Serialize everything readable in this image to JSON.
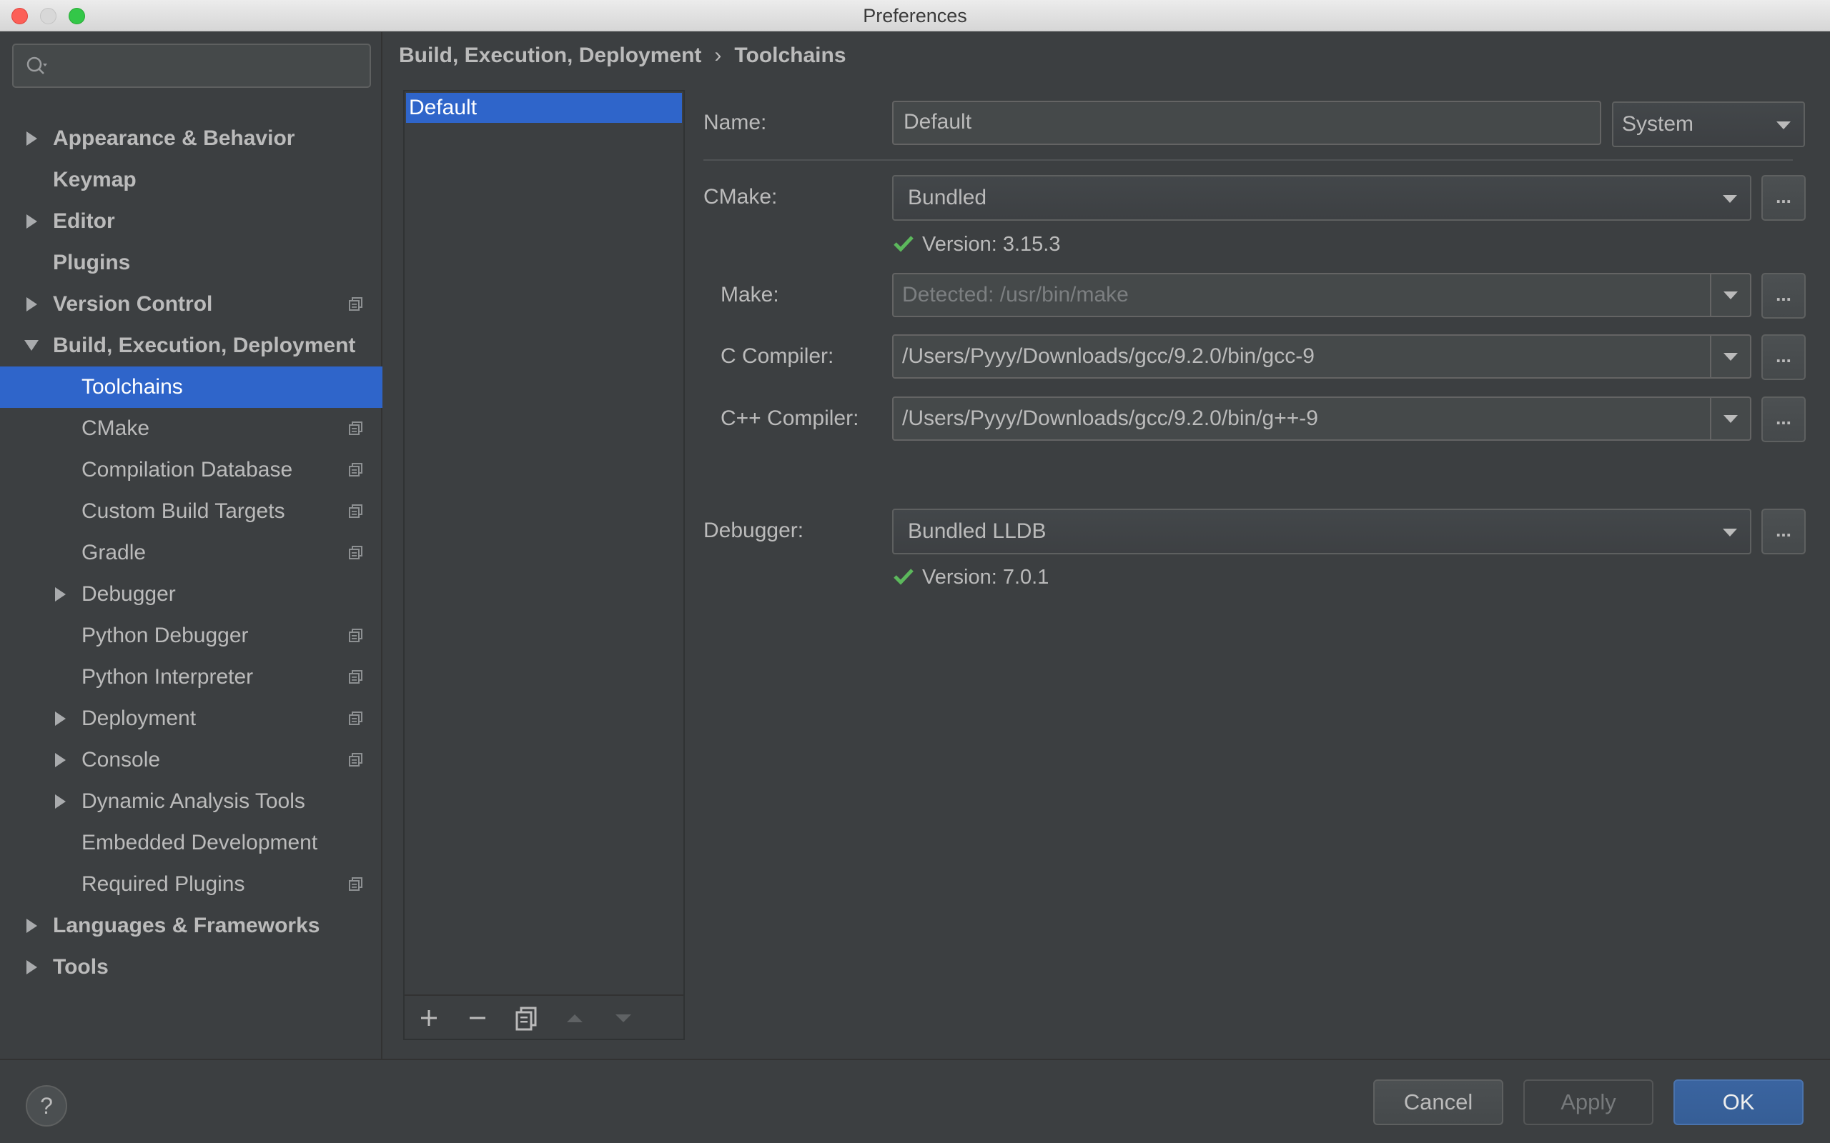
{
  "window": {
    "title": "Preferences"
  },
  "search": {
    "value": "",
    "placeholder": ""
  },
  "sidebar": {
    "items": [
      {
        "label": "Appearance & Behavior",
        "expandable": true,
        "expanded": false,
        "bold": true
      },
      {
        "label": "Keymap",
        "expandable": false,
        "bold": true
      },
      {
        "label": "Editor",
        "expandable": true,
        "expanded": false,
        "bold": true
      },
      {
        "label": "Plugins",
        "expandable": false,
        "bold": true
      },
      {
        "label": "Version Control",
        "expandable": true,
        "expanded": false,
        "bold": true,
        "project_icon": true
      },
      {
        "label": "Build, Execution, Deployment",
        "expandable": true,
        "expanded": true,
        "bold": true
      },
      {
        "label": "Toolchains",
        "selected": true,
        "indent": 1
      },
      {
        "label": "CMake",
        "indent": 1,
        "project_icon": true
      },
      {
        "label": "Compilation Database",
        "indent": 1,
        "project_icon": true
      },
      {
        "label": "Custom Build Targets",
        "indent": 1,
        "project_icon": true
      },
      {
        "label": "Gradle",
        "indent": 1,
        "project_icon": true
      },
      {
        "label": "Debugger",
        "indent": 1,
        "expandable": true,
        "expanded": false
      },
      {
        "label": "Python Debugger",
        "indent": 1,
        "project_icon": true
      },
      {
        "label": "Python Interpreter",
        "indent": 1,
        "project_icon": true
      },
      {
        "label": "Deployment",
        "indent": 1,
        "expandable": true,
        "expanded": false,
        "project_icon": true
      },
      {
        "label": "Console",
        "indent": 1,
        "expandable": true,
        "expanded": false,
        "project_icon": true
      },
      {
        "label": "Dynamic Analysis Tools",
        "indent": 1,
        "expandable": true,
        "expanded": false
      },
      {
        "label": "Embedded Development",
        "indent": 1
      },
      {
        "label": "Required Plugins",
        "indent": 1,
        "project_icon": true
      },
      {
        "label": "Languages & Frameworks",
        "expandable": true,
        "expanded": false,
        "bold": true
      },
      {
        "label": "Tools",
        "expandable": true,
        "expanded": false,
        "bold": true
      }
    ]
  },
  "breadcrumb": {
    "parent": "Build, Execution, Deployment",
    "separator": "›",
    "current": "Toolchains"
  },
  "toolchains": {
    "list": [
      "Default"
    ],
    "selected": "Default",
    "toolbar": {
      "add_icon": "plus-icon",
      "remove_icon": "minus-icon",
      "copy_icon": "copy-icon",
      "up_icon": "arrow-up-icon",
      "down_icon": "arrow-down-icon"
    }
  },
  "form": {
    "name_label": "Name:",
    "name_value": "Default",
    "environment": "System",
    "cmake_label": "CMake:",
    "cmake_value": "Bundled",
    "cmake_version": "Version: 3.15.3",
    "make_label": "Make:",
    "make_placeholder": "Detected: /usr/bin/make",
    "c_compiler_label": "C Compiler:",
    "c_compiler_value": "/Users/Pyyy/Downloads/gcc/9.2.0/bin/gcc-9",
    "cpp_compiler_label": "C++ Compiler:",
    "cpp_compiler_value": "/Users/Pyyy/Downloads/gcc/9.2.0/bin/g++-9",
    "debugger_label": "Debugger:",
    "debugger_value": "Bundled LLDB",
    "debugger_version": "Version: 7.0.1",
    "browse_label": "..."
  },
  "buttons": {
    "help": "?",
    "cancel": "Cancel",
    "apply": "Apply",
    "ok": "OK"
  },
  "colors": {
    "selection": "#2f65ca",
    "ok_button": "#365e96",
    "check": "#5cb85c"
  }
}
